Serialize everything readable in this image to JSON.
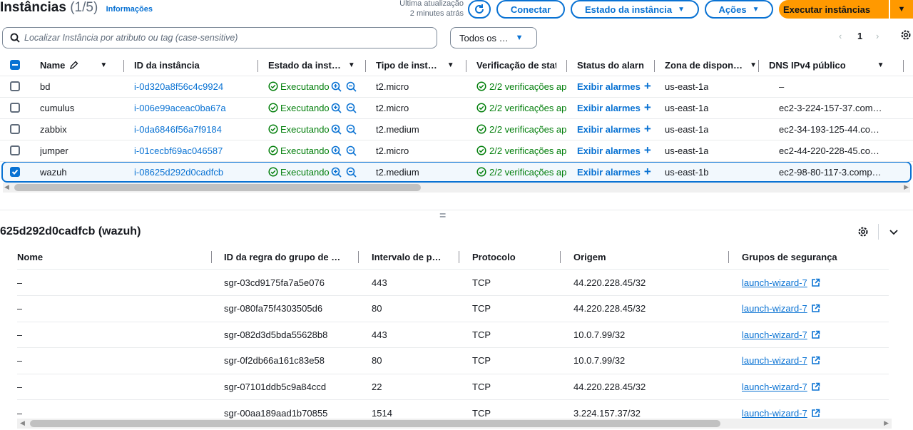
{
  "header": {
    "title": "Instâncias",
    "count": "(1/5)",
    "info_link": "Informações",
    "last_update_label": "Última atualização",
    "last_update_value": "2 minutes atrás",
    "connect_label": "Conectar",
    "instance_state_label": "Estado da instância",
    "actions_label": "Ações",
    "launch_label": "Executar instâncias"
  },
  "search": {
    "placeholder": "Localizar Instância por atributo ou tag (case-sensitive)",
    "filter_value": "Todos os …"
  },
  "pagination": {
    "current_page": "1"
  },
  "instances_table": {
    "columns": [
      "Name",
      "ID da instância",
      "Estado da inst…",
      "Tipo de inst…",
      "Verificação de stat",
      "Status do alarn",
      "Zona de dispon…",
      "DNS IPv4 público"
    ],
    "rows": [
      {
        "name": "bd",
        "id": "i-0d320a8f56c4c9924",
        "state": "Executando",
        "type": "t2.micro",
        "check": "2/2 verificações ap",
        "alarm": "Exibir alarmes",
        "zone": "us-east-1a",
        "dns": "–",
        "selected": false
      },
      {
        "name": "cumulus",
        "id": "i-006e99aceac0ba67a",
        "state": "Executando",
        "type": "t2.micro",
        "check": "2/2 verificações ap",
        "alarm": "Exibir alarmes",
        "zone": "us-east-1a",
        "dns": "ec2-3-224-157-37.com…",
        "selected": false
      },
      {
        "name": "zabbix",
        "id": "i-0da6846f56a7f9184",
        "state": "Executando",
        "type": "t2.medium",
        "check": "2/2 verificações ap",
        "alarm": "Exibir alarmes",
        "zone": "us-east-1a",
        "dns": "ec2-34-193-125-44.co…",
        "selected": false
      },
      {
        "name": "jumper",
        "id": "i-01cecbf69ac046587",
        "state": "Executando",
        "type": "t2.micro",
        "check": "2/2 verificações ap",
        "alarm": "Exibir alarmes",
        "zone": "us-east-1a",
        "dns": "ec2-44-220-228-45.co…",
        "selected": false
      },
      {
        "name": "wazuh",
        "id": "i-08625d292d0cadfcb",
        "state": "Executando",
        "type": "t2.medium",
        "check": "2/2 verificações ap",
        "alarm": "Exibir alarmes",
        "zone": "us-east-1b",
        "dns": "ec2-98-80-117-3.comp…",
        "selected": true
      }
    ]
  },
  "details": {
    "title": "625d292d0cadfcb (wazuh)",
    "columns": [
      "Nome",
      "ID da regra do grupo de …",
      "Intervalo de p…",
      "Protocolo",
      "Origem",
      "Grupos de segurança"
    ],
    "rows": [
      {
        "name": "–",
        "rule_id": "sgr-03cd9175fa7a5e076",
        "port": "443",
        "protocol": "TCP",
        "source": "44.220.228.45/32",
        "group": "launch-wizard-7"
      },
      {
        "name": "–",
        "rule_id": "sgr-080fa75f4303505d6",
        "port": "80",
        "protocol": "TCP",
        "source": "44.220.228.45/32",
        "group": "launch-wizard-7"
      },
      {
        "name": "–",
        "rule_id": "sgr-082d3d5bda55628b8",
        "port": "443",
        "protocol": "TCP",
        "source": "10.0.7.99/32",
        "group": "launch-wizard-7"
      },
      {
        "name": "–",
        "rule_id": "sgr-0f2db66a161c83e58",
        "port": "80",
        "protocol": "TCP",
        "source": "10.0.7.99/32",
        "group": "launch-wizard-7"
      },
      {
        "name": "–",
        "rule_id": "sgr-07101ddb5c9a84ccd",
        "port": "22",
        "protocol": "TCP",
        "source": "44.220.228.45/32",
        "group": "launch-wizard-7"
      },
      {
        "name": "–",
        "rule_id": "sgr-00aa189aad1b70855",
        "port": "1514",
        "protocol": "TCP",
        "source": "3.224.157.37/32",
        "group": "launch-wizard-7"
      }
    ]
  },
  "colors": {
    "accent": "#0972d3",
    "primary": "#ff9900",
    "success": "#037f0c"
  },
  "icons": [
    "refresh-icon",
    "search-icon",
    "gear-icon",
    "chevron-down-icon",
    "external-link-icon",
    "zoom-in-icon",
    "zoom-out-icon",
    "check-circle-icon",
    "edit-icon",
    "plus-icon"
  ]
}
